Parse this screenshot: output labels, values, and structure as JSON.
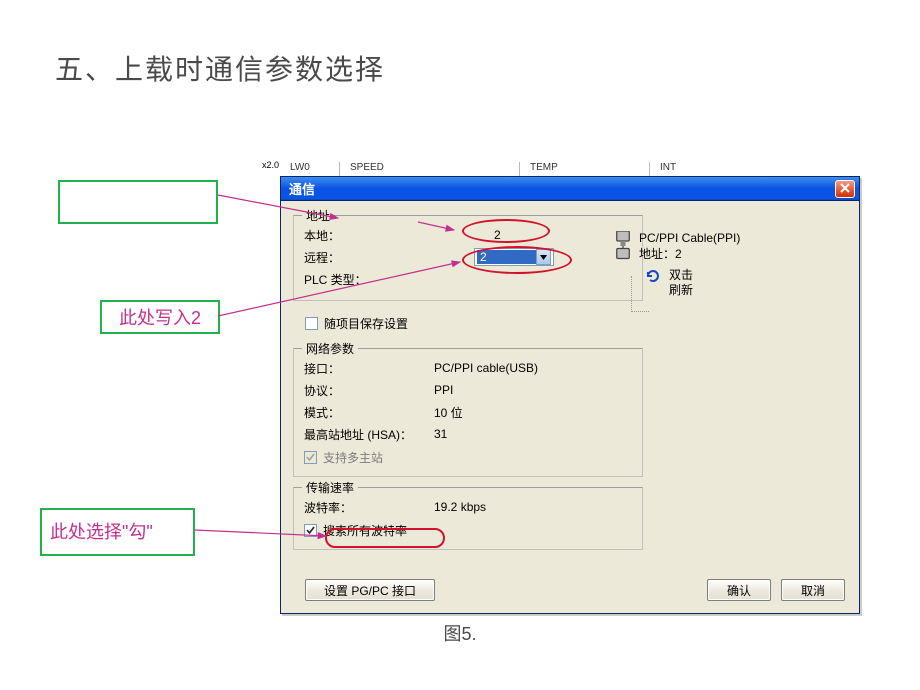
{
  "page": {
    "title": "五、上载时通信参数选择",
    "caption": "图5."
  },
  "callouts": {
    "c1": "",
    "c2": "此处写入2",
    "c3": "此处选择\"勾\""
  },
  "bgHeaders": {
    "x": "x2.0",
    "col0": "LW0",
    "col1": "SPEED",
    "col2": "TEMP",
    "col3": "INT"
  },
  "dialog": {
    "title": "通信",
    "close_icon": "close-icon",
    "address": {
      "legend": "地址",
      "local_label": "本地：",
      "local_value": "2",
      "remote_label": "远程：",
      "remote_value": "2",
      "plc_type_label": "PLC 类型：",
      "plc_type_value": ""
    },
    "save_with_project": "随项目保存设置",
    "network": {
      "legend": "网络参数",
      "interface_label": "接口：",
      "interface_value": "PC/PPI cable(USB)",
      "protocol_label": "协议：",
      "protocol_value": "PPI",
      "mode_label": "模式：",
      "mode_value": "10 位",
      "hsa_label": "最高站地址 (HSA)：",
      "hsa_value": "31",
      "multi_master": "支持多主站"
    },
    "transfer": {
      "legend": "传输速率",
      "baud_label": "波特率：",
      "baud_value": "19.2 kbps",
      "search_all": "搜索所有波特率"
    },
    "buttons": {
      "set_pgpc": "设置 PG/PC 接口",
      "ok": "确认",
      "cancel": "取消"
    },
    "tree": {
      "cable_name": "PC/PPI Cable(PPI)",
      "cable_addr": "地址：2",
      "refresh_l1": "双击",
      "refresh_l2": "刷新"
    }
  }
}
